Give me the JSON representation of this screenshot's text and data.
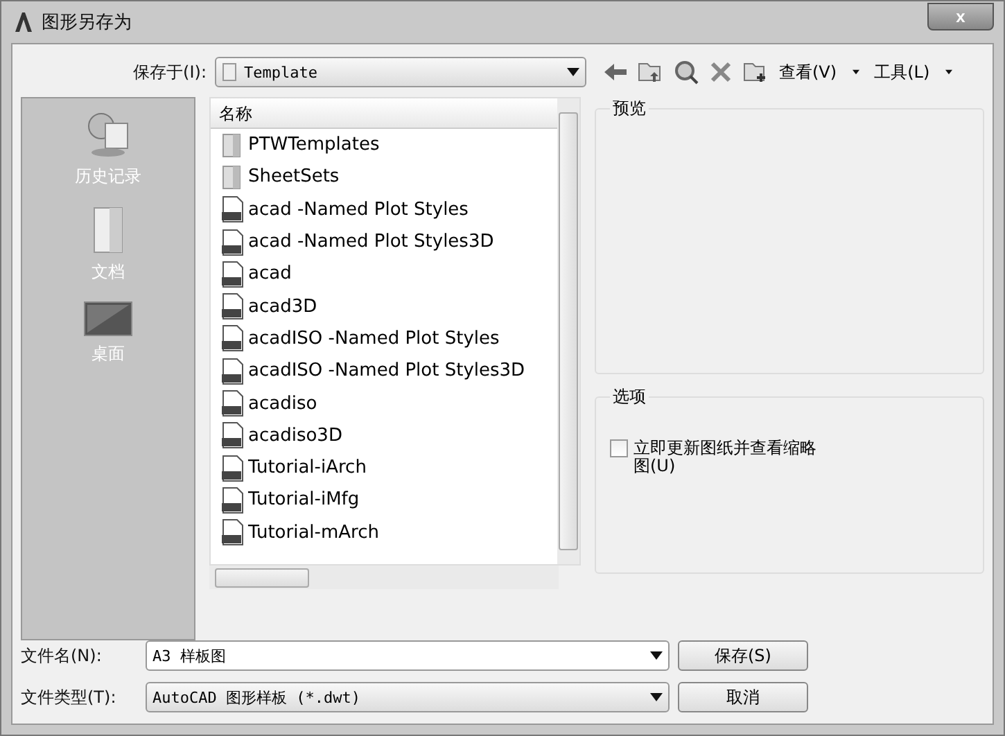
{
  "window": {
    "title": "图形另存为",
    "close": "x"
  },
  "save_in": {
    "label": "保存于(I):",
    "value": "Template"
  },
  "toolbar": {
    "menus": [
      {
        "label": "查看(V)"
      },
      {
        "label": "工具(L)"
      }
    ]
  },
  "places": [
    {
      "label": "历史记录",
      "kind": "history"
    },
    {
      "label": "文档",
      "kind": "documents"
    },
    {
      "label": "桌面",
      "kind": "desktop"
    }
  ],
  "file_list": {
    "column": "名称",
    "items": [
      {
        "name": "PTWTemplates",
        "kind": "folder"
      },
      {
        "name": "SheetSets",
        "kind": "folder"
      },
      {
        "name": "acad -Named Plot Styles",
        "kind": "dwt"
      },
      {
        "name": "acad -Named Plot Styles3D",
        "kind": "dwt"
      },
      {
        "name": "acad",
        "kind": "dwt"
      },
      {
        "name": "acad3D",
        "kind": "dwt"
      },
      {
        "name": "acadISO -Named Plot Styles",
        "kind": "dwt"
      },
      {
        "name": "acadISO -Named Plot Styles3D",
        "kind": "dwt"
      },
      {
        "name": "acadiso",
        "kind": "dwt"
      },
      {
        "name": "acadiso3D",
        "kind": "dwt"
      },
      {
        "name": "Tutorial-iArch",
        "kind": "dwt"
      },
      {
        "name": "Tutorial-iMfg",
        "kind": "dwt"
      },
      {
        "name": "Tutorial-mArch",
        "kind": "dwt"
      }
    ]
  },
  "preview": {
    "title": "预览"
  },
  "options": {
    "title": "选项",
    "checkbox": {
      "label": "立即更新图纸并查看缩略图(U)",
      "checked": false
    }
  },
  "file_name": {
    "label": "文件名(N):",
    "value": "A3 样板图"
  },
  "file_type": {
    "label": "文件类型(T):",
    "value": "AutoCAD 图形样板 (*.dwt)"
  },
  "buttons": [
    {
      "label": "保存(S)"
    },
    {
      "label": "取消"
    }
  ]
}
